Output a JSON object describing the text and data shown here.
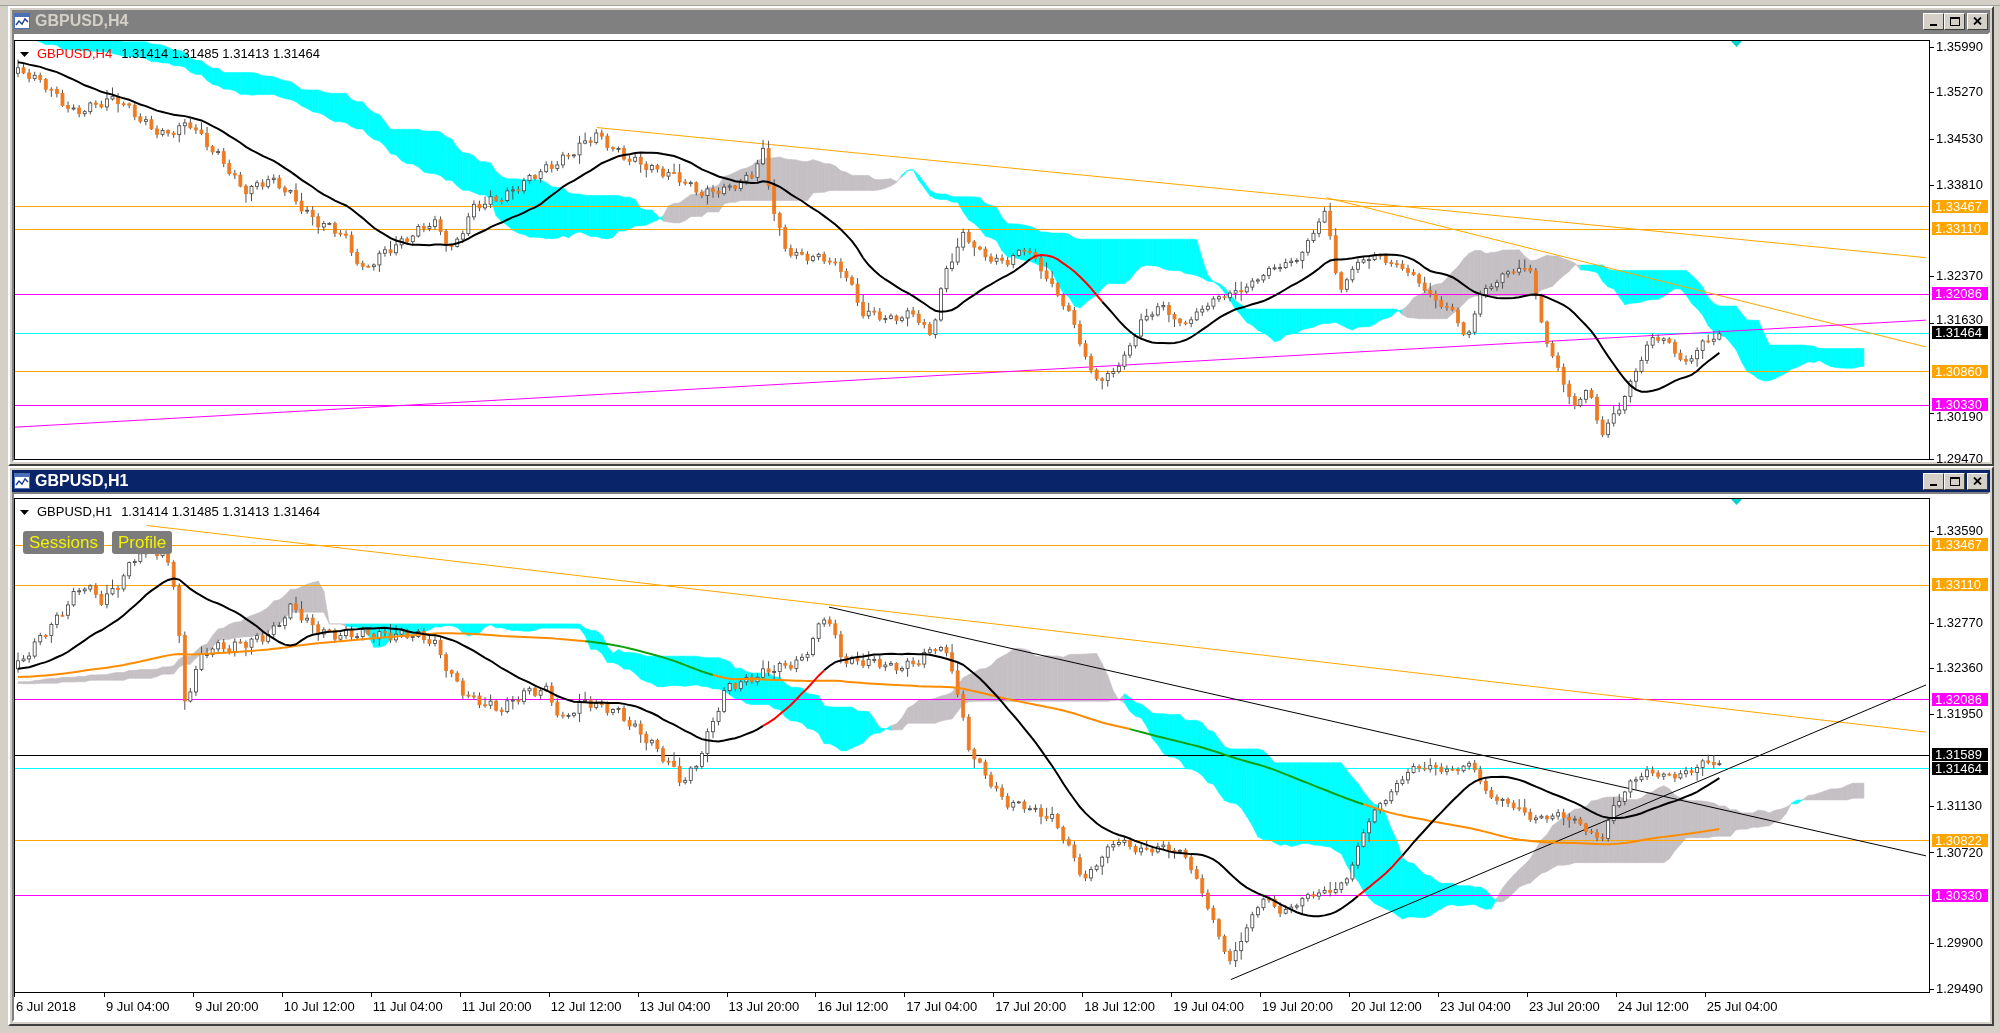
{
  "windows": [
    {
      "title": "GBPUSD,H4",
      "active": false,
      "header": {
        "symbol": "GBPUSD,H4",
        "color": "#ff0000",
        "ohlc": "1.31414 1.31485 1.31413 1.31464"
      },
      "y_axis": [
        "1.35990",
        "1.35270",
        "1.34530",
        "1.33810",
        "1.32370",
        "1.31630",
        "1.30190",
        "1.29470"
      ],
      "levels": [
        {
          "kind": "level",
          "price": "1.33467",
          "color": "#ffa500"
        },
        {
          "kind": "level",
          "price": "1.33110",
          "color": "#ffa500"
        },
        {
          "kind": "level",
          "price": "1.32086",
          "color": "#ff00ff"
        },
        {
          "kind": "bid",
          "price": "1.31464",
          "color": "#000000"
        },
        {
          "kind": "level",
          "price": "1.30860",
          "color": "#ffa500"
        },
        {
          "kind": "level",
          "price": "1.30330",
          "color": "#ff00ff"
        }
      ]
    },
    {
      "title": "GBPUSD,H1",
      "active": true,
      "header": {
        "symbol": "GBPUSD,H1",
        "color": "#000000",
        "ohlc": "1.31414 1.31485 1.31413 1.31464"
      },
      "buttons": [
        "Sessions",
        "Profile"
      ],
      "y_axis": [
        "1.33590",
        "1.32770",
        "1.32360",
        "1.31950",
        "1.31130",
        "1.30720",
        "1.29900",
        "1.29490"
      ],
      "levels": [
        {
          "kind": "level",
          "price": "1.33467",
          "color": "#ffa500"
        },
        {
          "kind": "level",
          "price": "1.33110",
          "color": "#ffa500"
        },
        {
          "kind": "level",
          "price": "1.32086",
          "color": "#ff00ff"
        },
        {
          "kind": "level",
          "price": "1.31589",
          "color": "#000000"
        },
        {
          "kind": "bid",
          "price": "1.31464",
          "color": "#000000"
        },
        {
          "kind": "level",
          "price": "1.30822",
          "color": "#ffa500"
        },
        {
          "kind": "level",
          "price": "1.30330",
          "color": "#ff00ff"
        }
      ],
      "x_axis": [
        "6 Jul 2018",
        "9 Jul 04:00",
        "9 Jul 20:00",
        "10 Jul 12:00",
        "11 Jul 04:00",
        "11 Jul 20:00",
        "12 Jul 12:00",
        "13 Jul 04:00",
        "13 Jul 20:00",
        "16 Jul 12:00",
        "17 Jul 04:00",
        "17 Jul 20:00",
        "18 Jul 12:00",
        "19 Jul 04:00",
        "19 Jul 20:00",
        "20 Jul 12:00",
        "23 Jul 04:00",
        "23 Jul 20:00",
        "24 Jul 12:00",
        "25 Jul 04:00"
      ]
    }
  ]
}
